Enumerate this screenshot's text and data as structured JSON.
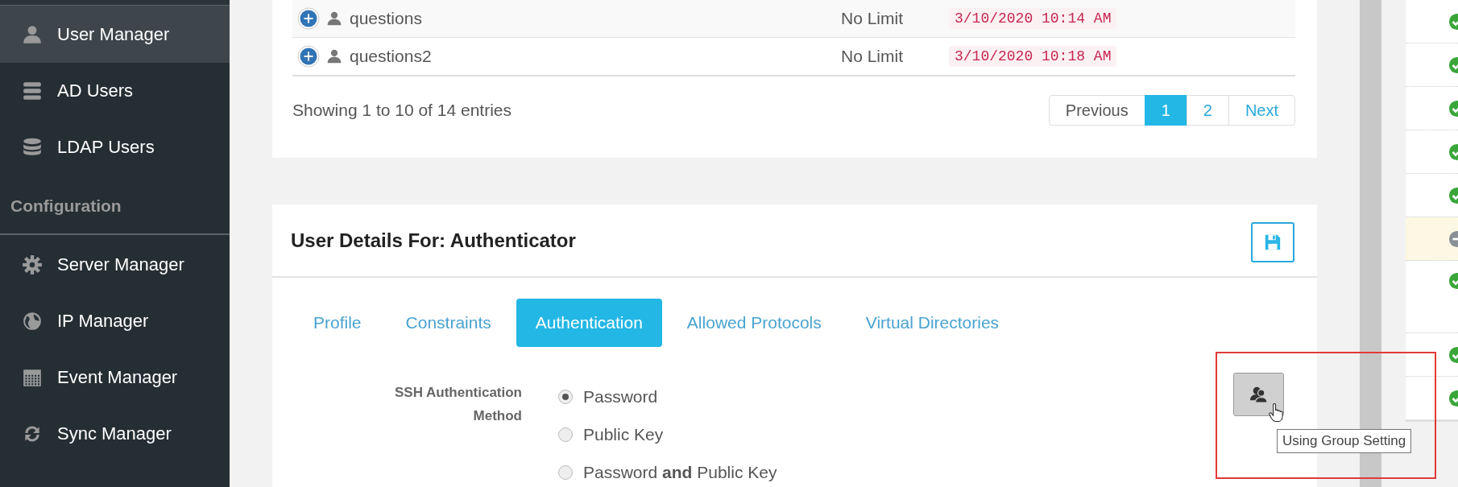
{
  "sidebar": {
    "items": [
      {
        "kind": "item",
        "label": "User Manager",
        "selected": true
      },
      {
        "kind": "item",
        "label": "AD Users",
        "selected": false
      },
      {
        "kind": "item",
        "label": "LDAP Users",
        "selected": false
      },
      {
        "kind": "header",
        "label": "Configuration"
      },
      {
        "kind": "item",
        "label": "Server Manager",
        "selected": false
      },
      {
        "kind": "item",
        "label": "IP Manager",
        "selected": false
      },
      {
        "kind": "item",
        "label": "Event Manager",
        "selected": false
      },
      {
        "kind": "item",
        "label": "Sync Manager",
        "selected": false
      }
    ]
  },
  "users_table": {
    "rows": [
      {
        "name": "questions",
        "limit": "No Limit",
        "date": "3/10/2020 10:14 AM"
      },
      {
        "name": "questions2",
        "limit": "No Limit",
        "date": "3/10/2020 10:18 AM"
      }
    ],
    "summary": "Showing 1 to 10 of 14 entries",
    "pagination": [
      {
        "label": "Previous",
        "selected": false
      },
      {
        "label": "1",
        "selected": true
      },
      {
        "label": "2",
        "selected": false
      },
      {
        "label": "Next",
        "selected": false
      }
    ]
  },
  "user_details": {
    "title": "User Details For: Authenticator",
    "tabs": [
      {
        "label": "Profile",
        "selected": false
      },
      {
        "label": "Constraints",
        "selected": false
      },
      {
        "label": "Authentication",
        "selected": true
      },
      {
        "label": "Allowed Protocols",
        "selected": false
      },
      {
        "label": "Virtual Directories",
        "selected": false
      }
    ],
    "ssh_method": {
      "label": "SSH Authentication Method",
      "options": [
        {
          "label": "Password",
          "checked": true
        },
        {
          "label": "Public Key",
          "checked": false
        },
        {
          "label": "Password **and** Public Key",
          "checked": false
        }
      ]
    },
    "group_setting_tooltip": "Using Group Setting"
  },
  "status_list": [
    {
      "kind": "ok",
      "highlighted": false
    },
    {
      "kind": "ok",
      "highlighted": false
    },
    {
      "kind": "ok",
      "highlighted": false
    },
    {
      "kind": "ok",
      "highlighted": false
    },
    {
      "kind": "ok",
      "highlighted": false
    },
    {
      "kind": "off",
      "highlighted": true
    },
    {
      "kind": "ok",
      "highlighted": false,
      "tall": true
    },
    {
      "kind": "ok",
      "highlighted": false
    },
    {
      "kind": "ok",
      "highlighted": false
    }
  ]
}
